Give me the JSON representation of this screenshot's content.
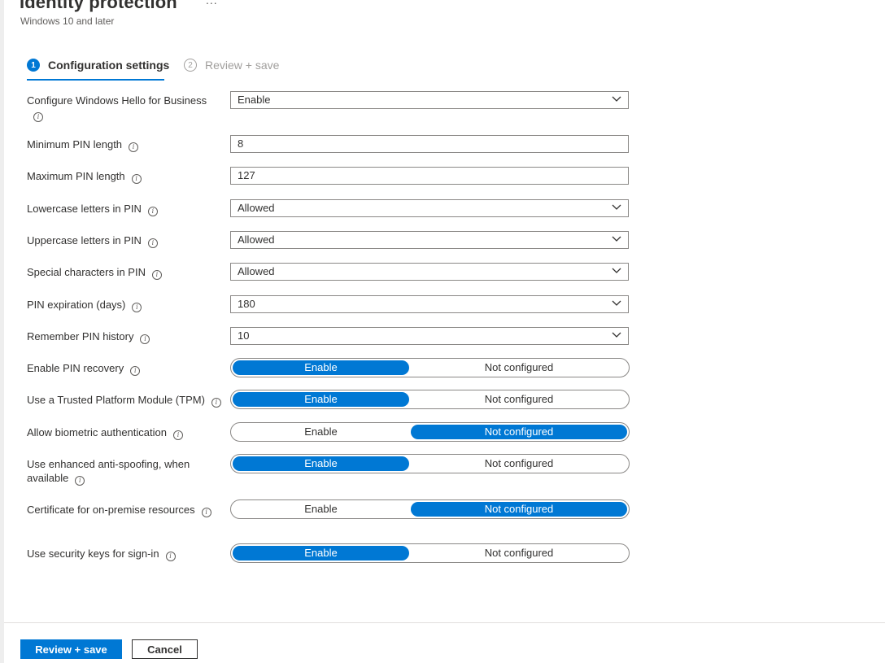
{
  "header": {
    "title": "Identity protection",
    "more": "...",
    "subtitle": "Windows 10 and later"
  },
  "wizard": {
    "steps": [
      {
        "number": "1",
        "label": "Configuration settings",
        "active": true
      },
      {
        "number": "2",
        "label": "Review + save",
        "active": false
      }
    ]
  },
  "settings": {
    "hello": {
      "label": "Configure Windows Hello for Business",
      "value": "Enable"
    },
    "min_pin": {
      "label": "Minimum PIN length",
      "value": "8"
    },
    "max_pin": {
      "label": "Maximum PIN length",
      "value": "127"
    },
    "lowercase": {
      "label": "Lowercase letters in PIN",
      "value": "Allowed"
    },
    "uppercase": {
      "label": "Uppercase letters in PIN",
      "value": "Allowed"
    },
    "special": {
      "label": "Special characters in PIN",
      "value": "Allowed"
    },
    "expiration": {
      "label": "PIN expiration (days)",
      "value": "180"
    },
    "history": {
      "label": "Remember PIN history",
      "value": "10"
    },
    "pin_recovery": {
      "label": "Enable PIN recovery",
      "selected": "Enable"
    },
    "tpm": {
      "label": "Use a Trusted Platform Module (TPM)",
      "selected": "Enable"
    },
    "biometric": {
      "label": "Allow biometric authentication",
      "selected": "Not configured"
    },
    "anti_spoofing": {
      "label": "Use enhanced anti-spoofing, when available",
      "selected": "Enable"
    },
    "certificate": {
      "label": "Certificate for on-premise resources",
      "selected": "Not configured"
    },
    "security_keys": {
      "label": "Use security keys for sign-in",
      "selected": "Enable"
    }
  },
  "toggle_options": {
    "left": "Enable",
    "right": "Not configured"
  },
  "footer": {
    "primary_label": "Review + save",
    "secondary_label": "Cancel"
  },
  "colors": {
    "accent": "#0078d4",
    "text": "#323130",
    "border": "#8a8886"
  }
}
